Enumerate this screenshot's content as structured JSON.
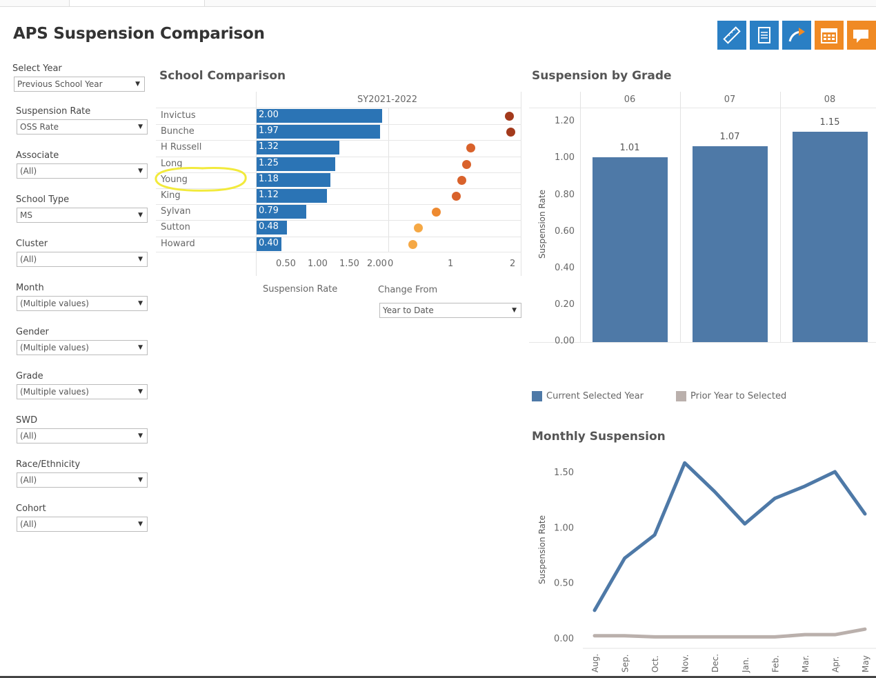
{
  "title": "APS Suspension Comparison",
  "toolbar": [
    {
      "name": "ruler-icon",
      "color": "#2a7fc4"
    },
    {
      "name": "document-icon",
      "color": "#2a7fc4"
    },
    {
      "name": "arrow-export-icon",
      "color": "#2a7fc4"
    },
    {
      "name": "calendar-icon",
      "color": "#f08a24"
    },
    {
      "name": "comment-icon",
      "color": "#f08a24"
    }
  ],
  "filters": [
    {
      "label": "Select Year",
      "value": "Previous School Year"
    },
    {
      "label": "Suspension Rate",
      "value": "OSS Rate"
    },
    {
      "label": "Associate",
      "value": "(All)"
    },
    {
      "label": "School Type",
      "value": "MS"
    },
    {
      "label": "Cluster",
      "value": "(All)"
    },
    {
      "label": "Month",
      "value": "(Multiple values)"
    },
    {
      "label": "Gender",
      "value": "(Multiple values)"
    },
    {
      "label": "Grade",
      "value": "(Multiple values)"
    },
    {
      "label": "SWD",
      "value": "(All)"
    },
    {
      "label": "Race/Ethnicity",
      "value": "(All)"
    },
    {
      "label": "Cohort",
      "value": "(All)"
    }
  ],
  "school_comparison": {
    "title": "School Comparison",
    "header": "SY2021-2022",
    "rate_axis_ticks": [
      "0.50",
      "1.00",
      "1.50",
      "2.00"
    ],
    "change_axis_ticks": [
      "0",
      "1",
      "2"
    ],
    "xlabel": "Suspension Rate",
    "change_from_label": "Change From",
    "change_from_value": "Year to Date"
  },
  "grade_chart": {
    "title": "Suspension by Grade",
    "ylabel": "Suspension Rate",
    "y_ticks": [
      "1.20",
      "1.00",
      "0.80",
      "0.60",
      "0.40",
      "0.20",
      "0.00"
    ],
    "legend": [
      {
        "label": "Current Selected Year",
        "color": "#4e79a7"
      },
      {
        "label": "Prior Year to Selected",
        "color": "#bab0ac"
      }
    ]
  },
  "monthly_chart": {
    "title": "Monthly Suspension",
    "ylabel": "Suspension Rate",
    "y_ticks": [
      "1.50",
      "1.00",
      "0.50",
      "0.00"
    ]
  },
  "chart_data": [
    {
      "type": "bar",
      "title": "School Comparison",
      "subtitle": "SY2021-2022",
      "categories": [
        "Invictus",
        "Bunche",
        "H Russell",
        "Long",
        "Young",
        "King",
        "Sylvan",
        "Sutton",
        "Howard"
      ],
      "series": [
        {
          "name": "Suspension Rate",
          "values": [
            2.0,
            1.97,
            1.32,
            1.25,
            1.18,
            1.12,
            0.79,
            0.48,
            0.4
          ]
        },
        {
          "name": "Change From",
          "values": [
            1.9,
            1.9,
            1.3,
            1.25,
            1.2,
            1.1,
            0.75,
            0.55,
            0.5
          ]
        }
      ],
      "xlabel": "Suspension Rate",
      "xlim": [
        0,
        2.05
      ]
    },
    {
      "type": "bar",
      "title": "Suspension by Grade",
      "categories": [
        "06",
        "07",
        "08"
      ],
      "values": [
        1.01,
        1.07,
        1.15
      ],
      "ylabel": "Suspension Rate",
      "ylim": [
        0,
        1.2
      ]
    },
    {
      "type": "line",
      "title": "Monthly Suspension",
      "x": [
        "Aug.",
        "Sep.",
        "Oct.",
        "Nov.",
        "Dec.",
        "Jan.",
        "Feb.",
        "Mar.",
        "Apr.",
        "May"
      ],
      "series": [
        {
          "name": "Current Selected Year",
          "color": "#4e79a7",
          "values": [
            0.25,
            0.72,
            0.93,
            1.58,
            1.32,
            1.03,
            1.26,
            1.37,
            1.5,
            1.12
          ]
        },
        {
          "name": "Prior Year to Selected",
          "color": "#bab0ac",
          "values": [
            0.02,
            0.02,
            0.01,
            0.01,
            0.01,
            0.01,
            0.01,
            0.03,
            0.03,
            0.08
          ]
        }
      ],
      "ylabel": "Suspension Rate",
      "ylim": [
        0,
        1.6
      ]
    }
  ]
}
